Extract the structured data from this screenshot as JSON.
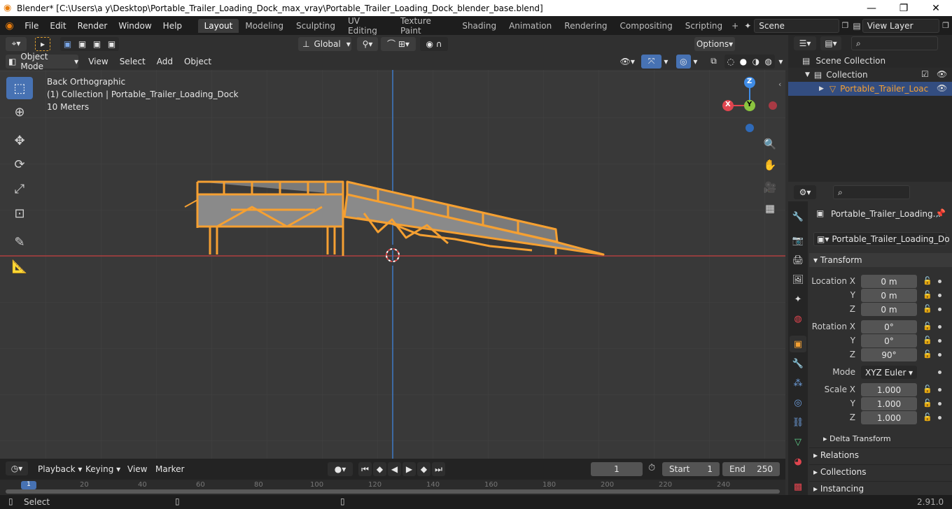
{
  "window": {
    "title": "Blender* [C:\\Users\\a y\\Desktop\\Portable_Trailer_Loading_Dock_max_vray\\Portable_Trailer_Loading_Dock_blender_base.blend]",
    "min": "—",
    "max": "❐",
    "close": "✕"
  },
  "menus": [
    "File",
    "Edit",
    "Render",
    "Window",
    "Help"
  ],
  "workspaces": [
    "Layout",
    "Modeling",
    "Sculpting",
    "UV Editing",
    "Texture Paint",
    "Shading",
    "Animation",
    "Rendering",
    "Compositing",
    "Scripting"
  ],
  "scene": "Scene",
  "view_layer": "View Layer",
  "header": {
    "options": "Options",
    "mode": "Object Mode",
    "view": "View",
    "select": "Select",
    "add": "Add",
    "object": "Object",
    "orientation": "Global"
  },
  "viewport": {
    "line1": "Back Orthographic",
    "line2": "(1) Collection | Portable_Trailer_Loading_Dock",
    "line3": "10 Meters",
    "gizmo": {
      "z": "Z",
      "y": "Y",
      "x": "X"
    }
  },
  "timeline": {
    "playback": "Playback",
    "keying": "Keying",
    "view": "View",
    "marker": "Marker",
    "frame": "1",
    "start_label": "Start",
    "start": "1",
    "end_label": "End",
    "end": "250",
    "ruler": [
      "1",
      "20",
      "40",
      "60",
      "80",
      "100",
      "120",
      "140",
      "160",
      "180",
      "200",
      "220",
      "240"
    ]
  },
  "status": {
    "left": "Select",
    "version": "2.91.0"
  },
  "outliner": {
    "scene_collection": "Scene Collection",
    "collection": "Collection",
    "object": "Portable_Trailer_Loac"
  },
  "properties": {
    "object_name": "Portable_Trailer_Loading...",
    "data_name": "Portable_Trailer_Loading_Do",
    "transform": "Transform",
    "location_x_label": "Location X",
    "y_label": "Y",
    "z_label": "Z",
    "loc_x": "0 m",
    "loc_y": "0 m",
    "loc_z": "0 m",
    "rotation_x_label": "Rotation X",
    "rot_x": "0°",
    "rot_y": "0°",
    "rot_z": "90°",
    "mode_label": "Mode",
    "mode": "XYZ Euler",
    "scale_x_label": "Scale X",
    "scale_x": "1.000",
    "scale_y": "1.000",
    "scale_z": "1.000",
    "delta": "Delta Transform",
    "relations": "Relations",
    "collections": "Collections",
    "instancing": "Instancing"
  },
  "colors": {
    "accent": "#4772b3",
    "selection": "#f5a032",
    "axis_x": "#e0454f",
    "axis_y": "#8bc53f",
    "axis_z": "#3f8ce6"
  }
}
